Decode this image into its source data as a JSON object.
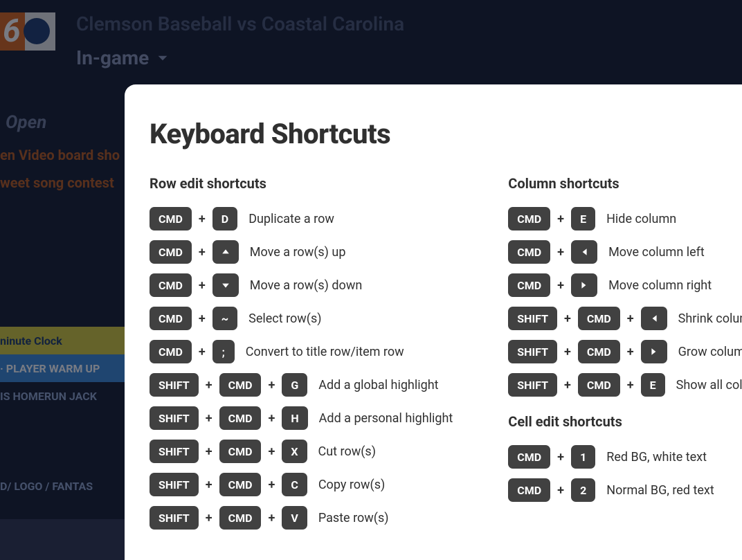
{
  "bg": {
    "event_title": "Clemson Baseball vs Coastal Carolina",
    "state_label": "In-game",
    "sidebar": {
      "open_label": "Open",
      "link1": "en Video board sho",
      "link2": "weet song contest",
      "row_yellow": "ninute Clock",
      "row_blue": "· PLAYER WARM UP",
      "row_dark": "IS HOMERUN JACK",
      "row_last": "D/ LOGO / FANTAS"
    }
  },
  "modal": {
    "title": "Keyboard Shortcuts",
    "row_section_title": "Row edit shortcuts",
    "col_section_title": "Column shortcuts",
    "cell_section_title": "Cell edit shortcuts",
    "row_shortcuts": [
      {
        "keys": [
          "CMD",
          "D"
        ],
        "desc": "Duplicate a row"
      },
      {
        "keys": [
          "CMD",
          "icon:up"
        ],
        "desc": "Move a row(s) up"
      },
      {
        "keys": [
          "CMD",
          "icon:down"
        ],
        "desc": "Move a row(s) down"
      },
      {
        "keys": [
          "CMD",
          "~"
        ],
        "desc": "Select row(s)"
      },
      {
        "keys": [
          "CMD",
          ";"
        ],
        "desc": "Convert to title row/item row"
      },
      {
        "keys": [
          "SHIFT",
          "CMD",
          "G"
        ],
        "desc": "Add a global highlight"
      },
      {
        "keys": [
          "SHIFT",
          "CMD",
          "H"
        ],
        "desc": "Add a personal highlight"
      },
      {
        "keys": [
          "SHIFT",
          "CMD",
          "X"
        ],
        "desc": "Cut row(s)"
      },
      {
        "keys": [
          "SHIFT",
          "CMD",
          "C"
        ],
        "desc": "Copy row(s)"
      },
      {
        "keys": [
          "SHIFT",
          "CMD",
          "V"
        ],
        "desc": "Paste row(s)"
      }
    ],
    "col_shortcuts": [
      {
        "keys": [
          "CMD",
          "E"
        ],
        "desc": "Hide column"
      },
      {
        "keys": [
          "CMD",
          "icon:left"
        ],
        "desc": "Move column left"
      },
      {
        "keys": [
          "CMD",
          "icon:right"
        ],
        "desc": "Move column right"
      },
      {
        "keys": [
          "SHIFT",
          "CMD",
          "icon:left"
        ],
        "desc": "Shrink column width"
      },
      {
        "keys": [
          "SHIFT",
          "CMD",
          "icon:right"
        ],
        "desc": "Grow column width"
      },
      {
        "keys": [
          "SHIFT",
          "CMD",
          "E"
        ],
        "desc": "Show all columns"
      }
    ],
    "cell_shortcuts": [
      {
        "keys": [
          "CMD",
          "1"
        ],
        "desc": "Red BG, white text"
      },
      {
        "keys": [
          "CMD",
          "2"
        ],
        "desc": "Normal BG, red text"
      }
    ]
  }
}
